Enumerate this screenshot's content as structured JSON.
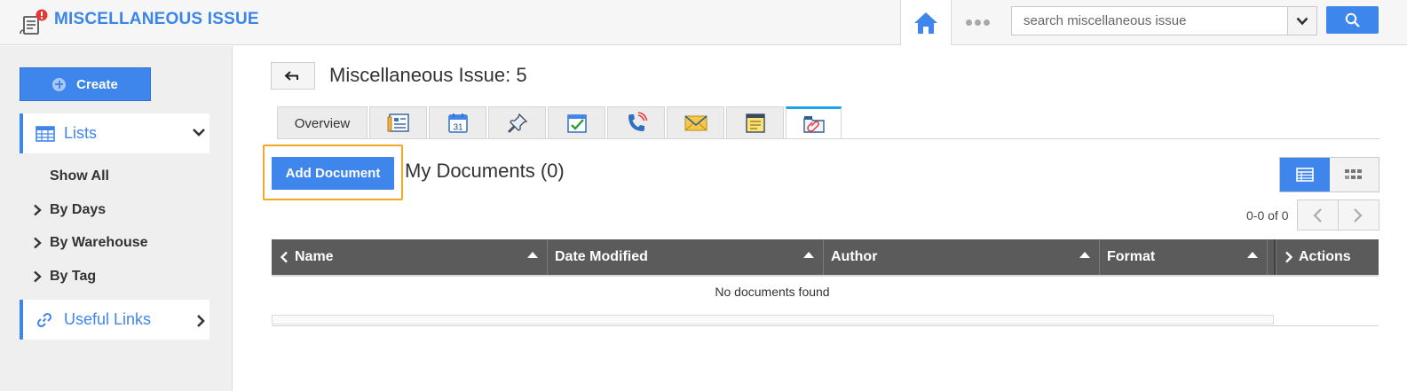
{
  "header": {
    "app_title": "MISCELLANEOUS ISSUE",
    "search": {
      "placeholder": "search miscellaneous issue",
      "value": ""
    },
    "accent_color": "#3e86ec",
    "badge_color": "#e53935"
  },
  "sidebar": {
    "create_label": "Create",
    "lists_label": "Lists",
    "show_all": "Show All",
    "items": [
      {
        "label": "By Days"
      },
      {
        "label": "By Warehouse"
      },
      {
        "label": "By Tag"
      }
    ],
    "useful_links_label": "Useful Links"
  },
  "main": {
    "page_title": "Miscellaneous Issue: 5",
    "tabs": [
      {
        "label": "Overview",
        "icon": ""
      },
      {
        "label": "",
        "icon": "details-icon"
      },
      {
        "label": "",
        "icon": "calendar-icon",
        "day": "31"
      },
      {
        "label": "",
        "icon": "pin-icon"
      },
      {
        "label": "",
        "icon": "task-check-icon"
      },
      {
        "label": "",
        "icon": "phone-call-icon"
      },
      {
        "label": "",
        "icon": "email-icon"
      },
      {
        "label": "",
        "icon": "notes-icon"
      },
      {
        "label": "",
        "icon": "attachment-icon",
        "active": true
      }
    ],
    "add_document_label": "Add Document",
    "documents_title": "My Documents (0)",
    "pager_text": "0-0 of 0",
    "table": {
      "columns": [
        "Name",
        "Date Modified",
        "Author",
        "Format",
        "Actions"
      ],
      "empty_text": "No documents found"
    },
    "highlight_color": "#f5a623"
  }
}
